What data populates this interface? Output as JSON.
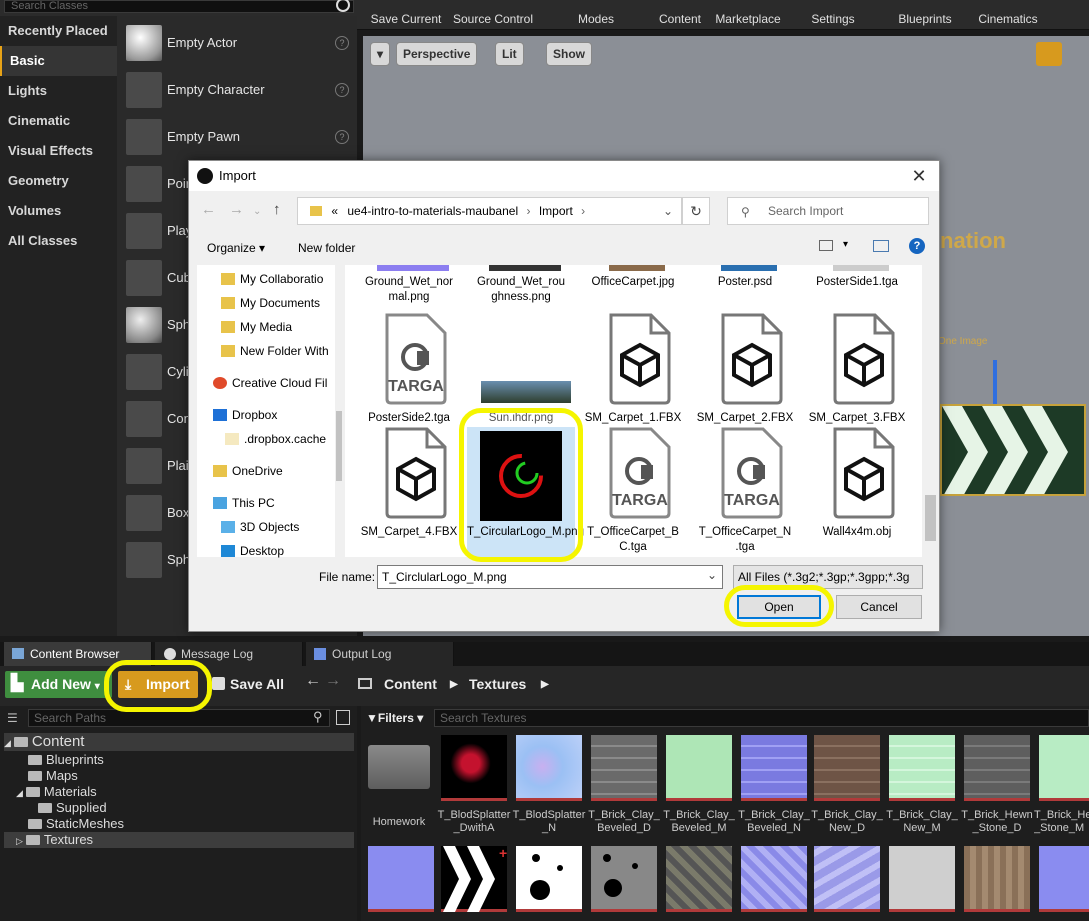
{
  "toolbar": {
    "search_placeholder": "Search Classes",
    "buttons": [
      "Save Current",
      "Source Control",
      "Modes",
      "Content",
      "Marketplace",
      "Settings",
      "Blueprints",
      "Cinematics"
    ]
  },
  "modes": {
    "categories": [
      "Recently Placed",
      "Basic",
      "Lights",
      "Cinematic",
      "Visual Effects",
      "Geometry",
      "Volumes",
      "All Classes"
    ],
    "selected": "Basic",
    "items": [
      "Empty Actor",
      "Empty Character",
      "Empty Pawn",
      "Poir",
      "Play",
      "Cub",
      "Sph",
      "Cyli",
      "Con",
      "Plai",
      "Box",
      "Sph"
    ]
  },
  "viewport": {
    "buttons": [
      "Perspective",
      "Lit",
      "Show"
    ],
    "overlay_text": "nation",
    "overlay_small": "One Image"
  },
  "dialog": {
    "title": "Import",
    "address": {
      "prefix": "«",
      "parts": [
        "ue4-intro-to-materials-maubanel",
        "Import"
      ]
    },
    "search_placeholder": "Search Import",
    "organize": "Organize",
    "new_folder": "New folder",
    "nav_items": [
      "My Collaboratio",
      "My Documents",
      "My Media",
      "New Folder With",
      "Creative Cloud Fil",
      "Dropbox",
      ".dropbox.cache",
      "OneDrive",
      "This PC",
      "3D Objects",
      "Desktop"
    ],
    "files_row0": [
      "Ground_Wet_nor mal.png",
      "Ground_Wet_rou ghness.png",
      "OfficeCarpet.jpg",
      "Poster.psd",
      "PosterSide1.tga"
    ],
    "files_row1": [
      "PosterSide2.tga",
      "Sun.ihdr.png",
      "SM_Carpet_1.FBX",
      "SM_Carpet_2.FBX",
      "SM_Carpet_3.FBX"
    ],
    "files_row2": [
      "SM_Carpet_4.FBX",
      "T_CircularLogo_M.png",
      "T_OfficeCarpet_B C.tga",
      "T_OfficeCarpet_N .tga",
      "Wall4x4m.obj"
    ],
    "targa_label": "TARGA",
    "file_name_label": "File name:",
    "file_name_value": "T_CirclularLogo_M.png",
    "file_type": "All Files (*.3g2;*.3gp;*.3gpp;*.3g",
    "open": "Open",
    "cancel": "Cancel"
  },
  "content_browser": {
    "tabs": [
      "Content Browser",
      "Message Log",
      "Output Log"
    ],
    "add_new": "Add New",
    "import": "Import",
    "save_all": "Save All",
    "breadcrumb": [
      "Content",
      "Textures"
    ],
    "search_paths_placeholder": "Search Paths",
    "filters": "Filters",
    "search_textures_placeholder": "Search Textures",
    "tree": [
      "Content",
      "Blueprints",
      "Maps",
      "Materials",
      "Supplied",
      "StaticMeshes",
      "Textures"
    ],
    "assets_row1": [
      "Homework",
      "T_BlodSplatter _DwithA",
      "T_BlodSplatter _N",
      "T_Brick_Clay_ Beveled_D",
      "T_Brick_Clay_ Beveled_M",
      "T_Brick_Clay_ Beveled_N",
      "T_Brick_Clay_ New_D",
      "T_Brick_Clay_ New_M",
      "T_Brick_Hewn _Stone_D",
      "T_Brick_He _Stone_M"
    ]
  },
  "colors": {
    "highlight": "#f5f500",
    "accent": "#e8a317",
    "import_btn": "#d79a1e",
    "add_new": "#3f8e3f"
  }
}
